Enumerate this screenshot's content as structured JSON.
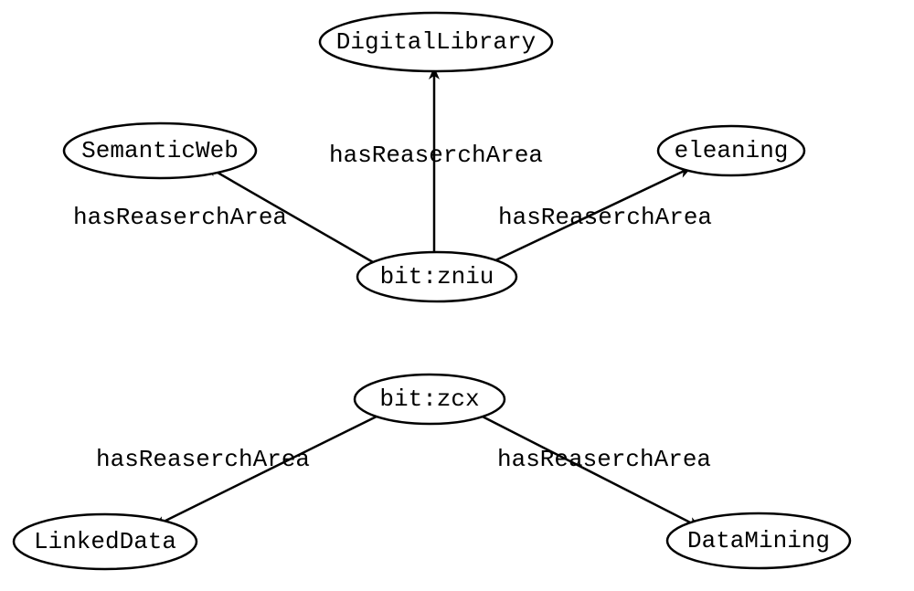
{
  "nodes": {
    "digitalLibrary": "DigitalLibrary",
    "semanticWeb": "SemanticWeb",
    "eleaning": "eleaning",
    "bitZniu": "bit:zniu",
    "bitZcx": "bit:zcx",
    "linkedData": "LinkedData",
    "dataMining": "DataMining"
  },
  "edges": {
    "zniuToDigital": "hasReaserchArea",
    "zniuToSemantic": "hasReaserchArea",
    "zniuToEleaning": "hasReaserchArea",
    "zcxToLinked": "hasReaserchArea",
    "zcxToDataMining": "hasReaserchArea"
  }
}
